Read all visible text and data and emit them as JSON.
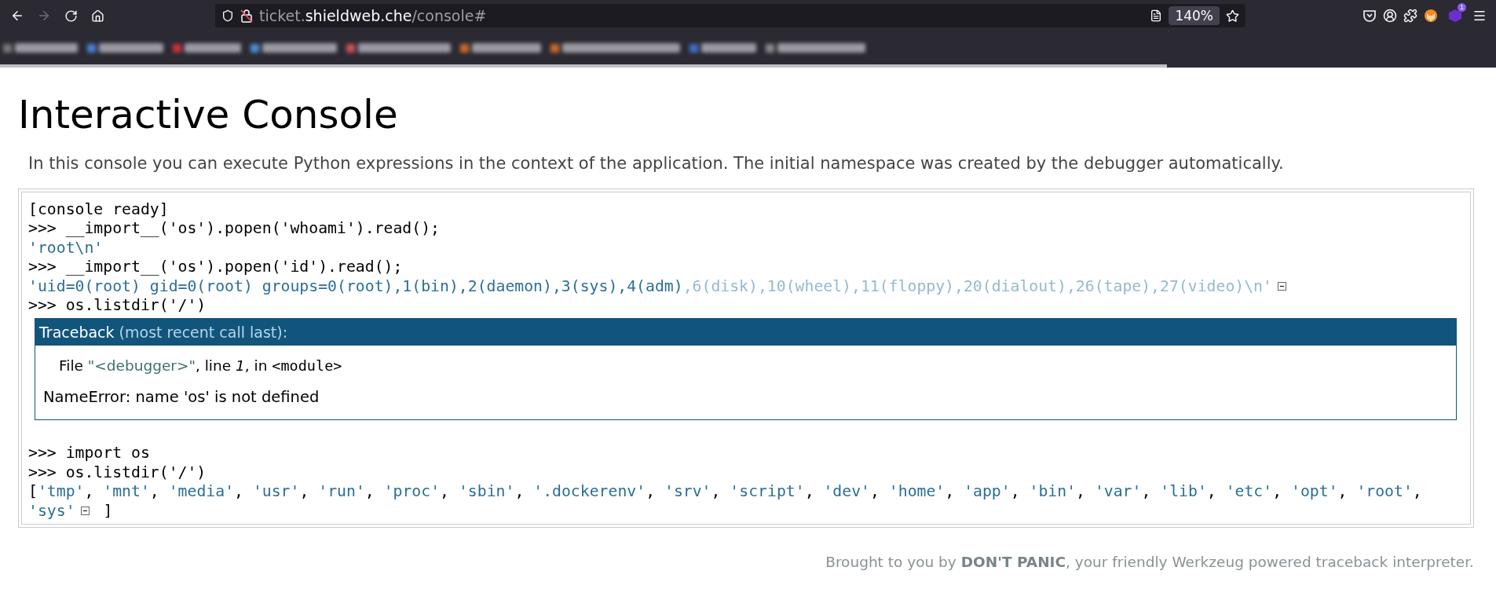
{
  "browser": {
    "url": {
      "subdomain": "ticket.",
      "domain": "shieldweb.che",
      "path": "/console#"
    },
    "zoom": "140%",
    "forward_disabled": true,
    "extension_badge": "1",
    "load_progress": {
      "level": 0.78
    }
  },
  "title": "Interactive Console",
  "intro": "In this console you can execute Python expressions in the context of the application. The initial namespace was created by the debugger automatically.",
  "console": [
    {
      "kind": "line",
      "segments": [
        {
          "kind": "plain",
          "text": "[console ready]"
        }
      ]
    },
    {
      "kind": "line",
      "segments": [
        {
          "kind": "plain",
          "text": ">>> __import__('os').popen('whoami').read();"
        }
      ]
    },
    {
      "kind": "line",
      "segments": [
        {
          "kind": "string",
          "text": "'root\\n'"
        }
      ]
    },
    {
      "kind": "line",
      "segments": [
        {
          "kind": "plain",
          "text": ">>> __import__('os').popen('id').read();"
        }
      ]
    },
    {
      "kind": "line",
      "segments": [
        {
          "kind": "string",
          "text": "'uid=0(root) gid=0(root) groups=0(root),1(bin),2(daemon),3(sys),4(adm)"
        },
        {
          "kind": "dim",
          "text": ",6(disk),10(wheel),11(floppy),20(dialout),26(tape),27(video)\\n'"
        },
        {
          "kind": "toggle",
          "expanded": true
        }
      ]
    },
    {
      "kind": "line",
      "segments": [
        {
          "kind": "plain",
          "text": ">>> os.listdir('/')"
        }
      ]
    },
    {
      "kind": "traceback",
      "header": "Traceback",
      "header_note": "(most recent call last):",
      "frame": {
        "prefix": "File",
        "filename": "\"<debugger>\"",
        "line_label": ", line",
        "line": "1",
        "in_label": ", in",
        "function": "<module>"
      },
      "error": "NameError: name 'os' is not defined"
    },
    {
      "kind": "line",
      "segments": [
        {
          "kind": "plain",
          "text": ">>> import os"
        }
      ]
    },
    {
      "kind": "line",
      "segments": [
        {
          "kind": "plain",
          "text": ">>> os.listdir('/')"
        }
      ]
    },
    {
      "kind": "line",
      "segments": [
        {
          "kind": "plain",
          "text": "["
        },
        {
          "kind": "string",
          "text": "'tmp'"
        },
        {
          "kind": "plain",
          "text": ", "
        },
        {
          "kind": "string",
          "text": "'mnt'"
        },
        {
          "kind": "plain",
          "text": ", "
        },
        {
          "kind": "string",
          "text": "'media'"
        },
        {
          "kind": "plain",
          "text": ", "
        },
        {
          "kind": "string",
          "text": "'usr'"
        },
        {
          "kind": "plain",
          "text": ", "
        },
        {
          "kind": "string",
          "text": "'run'"
        },
        {
          "kind": "plain",
          "text": ", "
        },
        {
          "kind": "string",
          "text": "'proc'"
        },
        {
          "kind": "plain",
          "text": ", "
        },
        {
          "kind": "string",
          "text": "'sbin'"
        },
        {
          "kind": "plain",
          "text": ", "
        },
        {
          "kind": "string",
          "text": "'.dockerenv'"
        },
        {
          "kind": "plain",
          "text": ", "
        },
        {
          "kind": "string",
          "text": "'srv'"
        },
        {
          "kind": "plain",
          "text": ", "
        },
        {
          "kind": "string",
          "text": "'script'"
        },
        {
          "kind": "plain",
          "text": ", "
        },
        {
          "kind": "string",
          "text": "'dev'"
        },
        {
          "kind": "plain",
          "text": ", "
        },
        {
          "kind": "string",
          "text": "'home'"
        },
        {
          "kind": "plain",
          "text": ", "
        },
        {
          "kind": "string",
          "text": "'app'"
        },
        {
          "kind": "plain",
          "text": ", "
        },
        {
          "kind": "string",
          "text": "'bin'"
        },
        {
          "kind": "plain",
          "text": ", "
        },
        {
          "kind": "string",
          "text": "'var'"
        },
        {
          "kind": "plain",
          "text": ", "
        },
        {
          "kind": "string",
          "text": "'lib'"
        },
        {
          "kind": "plain",
          "text": ", "
        },
        {
          "kind": "string",
          "text": "'etc'"
        },
        {
          "kind": "plain",
          "text": ", "
        },
        {
          "kind": "string",
          "text": "'opt'"
        },
        {
          "kind": "plain",
          "text": ", "
        },
        {
          "kind": "string",
          "text": "'root'"
        },
        {
          "kind": "plain",
          "text": ","
        }
      ]
    },
    {
      "kind": "line",
      "segments": [
        {
          "kind": "string",
          "text": "'sys'"
        },
        {
          "kind": "toggle",
          "expanded": true
        },
        {
          "kind": "plain",
          "text": " ]"
        }
      ]
    }
  ],
  "footer": {
    "prefix": "Brought to you by",
    "brand": "DON'T PANIC",
    "suffix": ", your friendly Werkzeug powered traceback interpreter."
  }
}
